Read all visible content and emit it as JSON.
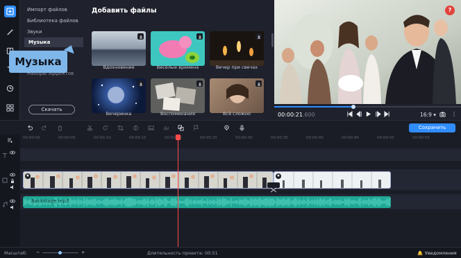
{
  "categories": {
    "items": [
      "Импорт файлов",
      "Библиотека файлов",
      "Звуки",
      "Музыка"
    ],
    "partial_item": "Наборы эффектов",
    "download_button": "Скачать"
  },
  "callout": {
    "label": "Музыка"
  },
  "files": {
    "title": "Добавить файлы",
    "tiles": [
      {
        "caption": "Вдохновение"
      },
      {
        "caption": "Весёлые времена"
      },
      {
        "caption": "Вечер при свечах"
      },
      {
        "caption": "Вечеринка"
      },
      {
        "caption": "Воспоминания"
      },
      {
        "caption": "Всё сложно"
      }
    ]
  },
  "player": {
    "time": "00:00:21",
    "time_ms": ".600",
    "aspect": "16:9 ▾",
    "progress_fraction": 0.42
  },
  "help": {
    "label": "?"
  },
  "toolbar": {
    "save_label": "Сохранить"
  },
  "ruler": {
    "ticks": [
      "00:00:00",
      "00:00:05",
      "00:00:10",
      "00:00:15",
      "00:00:20",
      "00:00:25",
      "00:00:30",
      "00:00:35",
      "00:00:40",
      "00:00:45",
      "00:00:50",
      "00:00:55"
    ]
  },
  "audio_clip": {
    "label": "Backstage.mp3"
  },
  "statusbar": {
    "zoom_label": "Масштаб:",
    "duration_label": "Длительность проекта: 00:51",
    "notifications": "Уведомления"
  },
  "colors": {
    "accent": "#2f8dff",
    "audio": "#1fa896",
    "playhead": "#ff4b4b",
    "help": "#e2433d",
    "callout": "#7fb7ea"
  }
}
